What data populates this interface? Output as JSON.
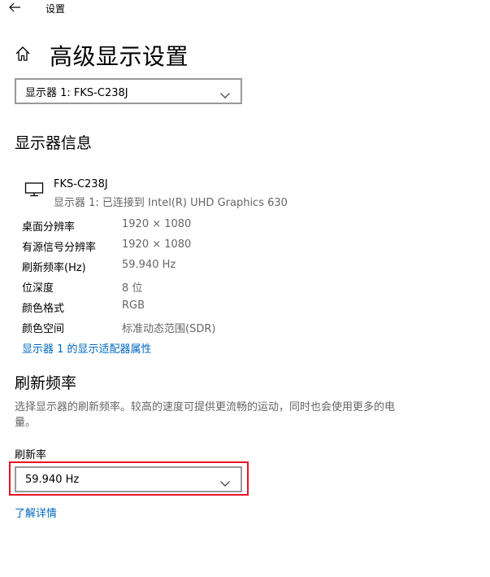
{
  "titlebar": {
    "title": "设置"
  },
  "page": {
    "title": "高级显示设置"
  },
  "display_select": {
    "value": "显示器 1: FKS-C238J"
  },
  "display_info": {
    "heading": "显示器信息",
    "monitor_name": "FKS-C238J",
    "monitor_sub": "显示器 1: 已连接到 Intel(R) UHD Graphics 630",
    "rows": [
      {
        "label": "桌面分辨率",
        "value": "1920 × 1080"
      },
      {
        "label": "有源信号分辨率",
        "value": "1920 × 1080"
      },
      {
        "label": "刷新频率(Hz)",
        "value": "59.940 Hz"
      },
      {
        "label": "位深度",
        "value": "8 位"
      },
      {
        "label": "颜色格式",
        "value": "RGB"
      },
      {
        "label": "颜色空间",
        "value": "标准动态范围(SDR)"
      }
    ],
    "adapter_link": "显示器 1 的显示适配器属性"
  },
  "refresh": {
    "heading": "刷新频率",
    "description": "选择显示器的刷新频率。较高的速度可提供更流畅的运动，同时也会使用更多的电量。",
    "rate_label": "刷新率",
    "rate_value": "59.940 Hz",
    "learn_more": "了解详情"
  },
  "colors": {
    "link": "#0067c0",
    "highlight": "#e81123",
    "secondary_text": "#666666"
  },
  "icons": [
    "back-arrow-icon",
    "home-icon",
    "monitor-icon",
    "chevron-down-icon"
  ]
}
